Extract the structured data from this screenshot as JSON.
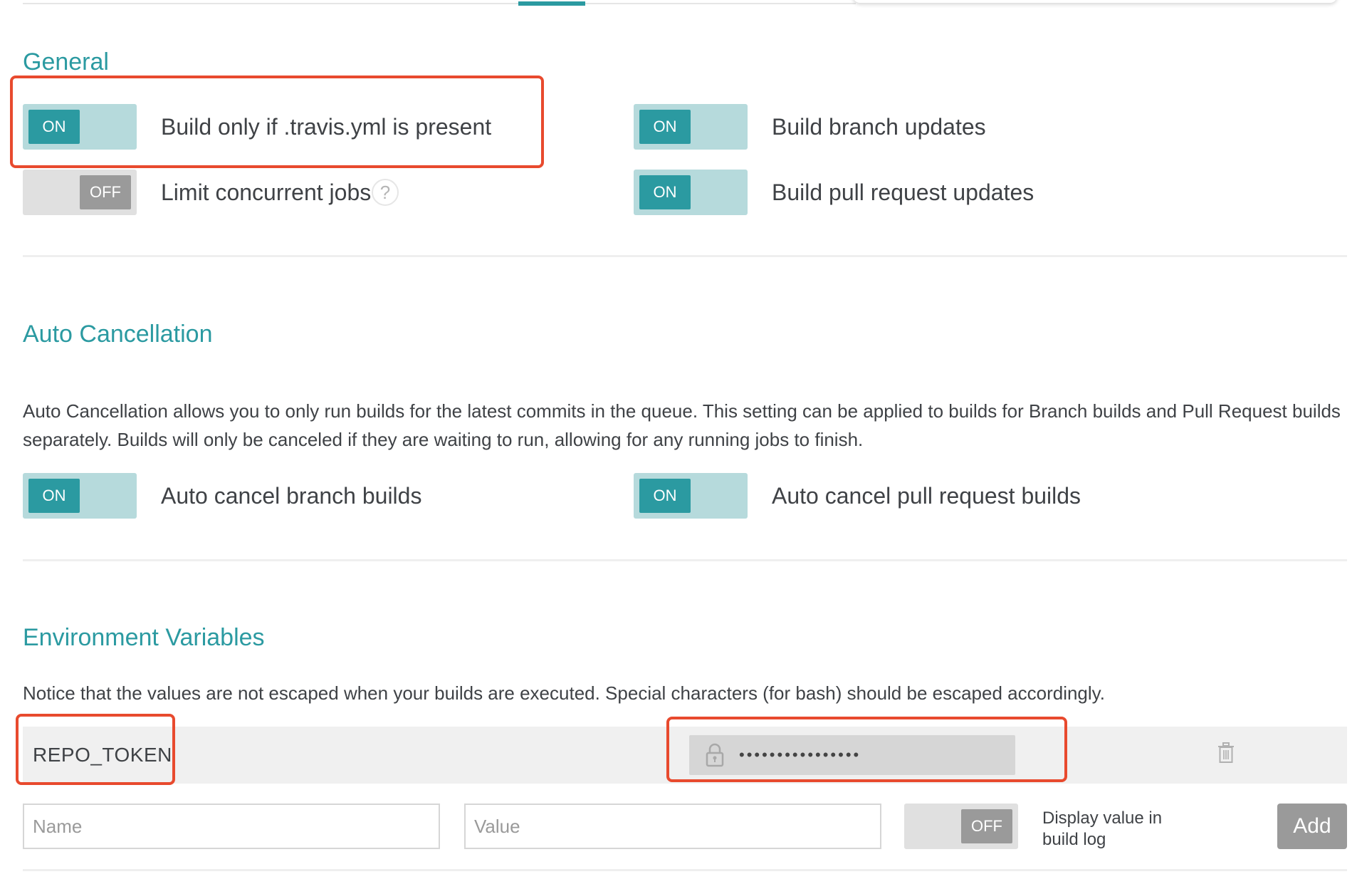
{
  "general": {
    "title": "General",
    "settings": [
      {
        "label": "Build only if .travis.yml is present",
        "state": "ON"
      },
      {
        "label": "Build branch updates",
        "state": "ON"
      },
      {
        "label": "Limit concurrent jobs",
        "state": "OFF",
        "help": "?"
      },
      {
        "label": "Build pull request updates",
        "state": "ON"
      }
    ]
  },
  "auto_cancellation": {
    "title": "Auto Cancellation",
    "description": "Auto Cancellation allows you to only run builds for the latest commits in the queue. This setting can be applied to builds for Branch builds and Pull Request builds separately. Builds will only be canceled if they are waiting to run, allowing for any running jobs to finish.",
    "settings": [
      {
        "label": "Auto cancel branch builds",
        "state": "ON"
      },
      {
        "label": "Auto cancel pull request builds",
        "state": "ON"
      }
    ]
  },
  "env_vars": {
    "title": "Environment Variables",
    "notice": "Notice that the values are not escaped when your builds are executed. Special characters (for bash) should be escaped accordingly.",
    "variables": [
      {
        "name": "REPO_TOKEN",
        "value_masked": "••••••••••••••••"
      }
    ],
    "new_name_placeholder": "Name",
    "new_value_placeholder": "Value",
    "display_toggle_state": "OFF",
    "display_label_line1": "Display value in",
    "display_label_line2": "build log",
    "add_label": "Add"
  },
  "colors": {
    "accent": "#2b9aa1",
    "toggle_on_track": "#b6dadc",
    "toggle_off_track": "#e0e0e0",
    "toggle_off_knob": "#9a9a9a",
    "highlight": "#e84a2e",
    "button_disabled": "#9a9a9a"
  },
  "icons": {
    "help": "question-mark-circle",
    "lock": "padlock",
    "delete": "trash-can"
  }
}
